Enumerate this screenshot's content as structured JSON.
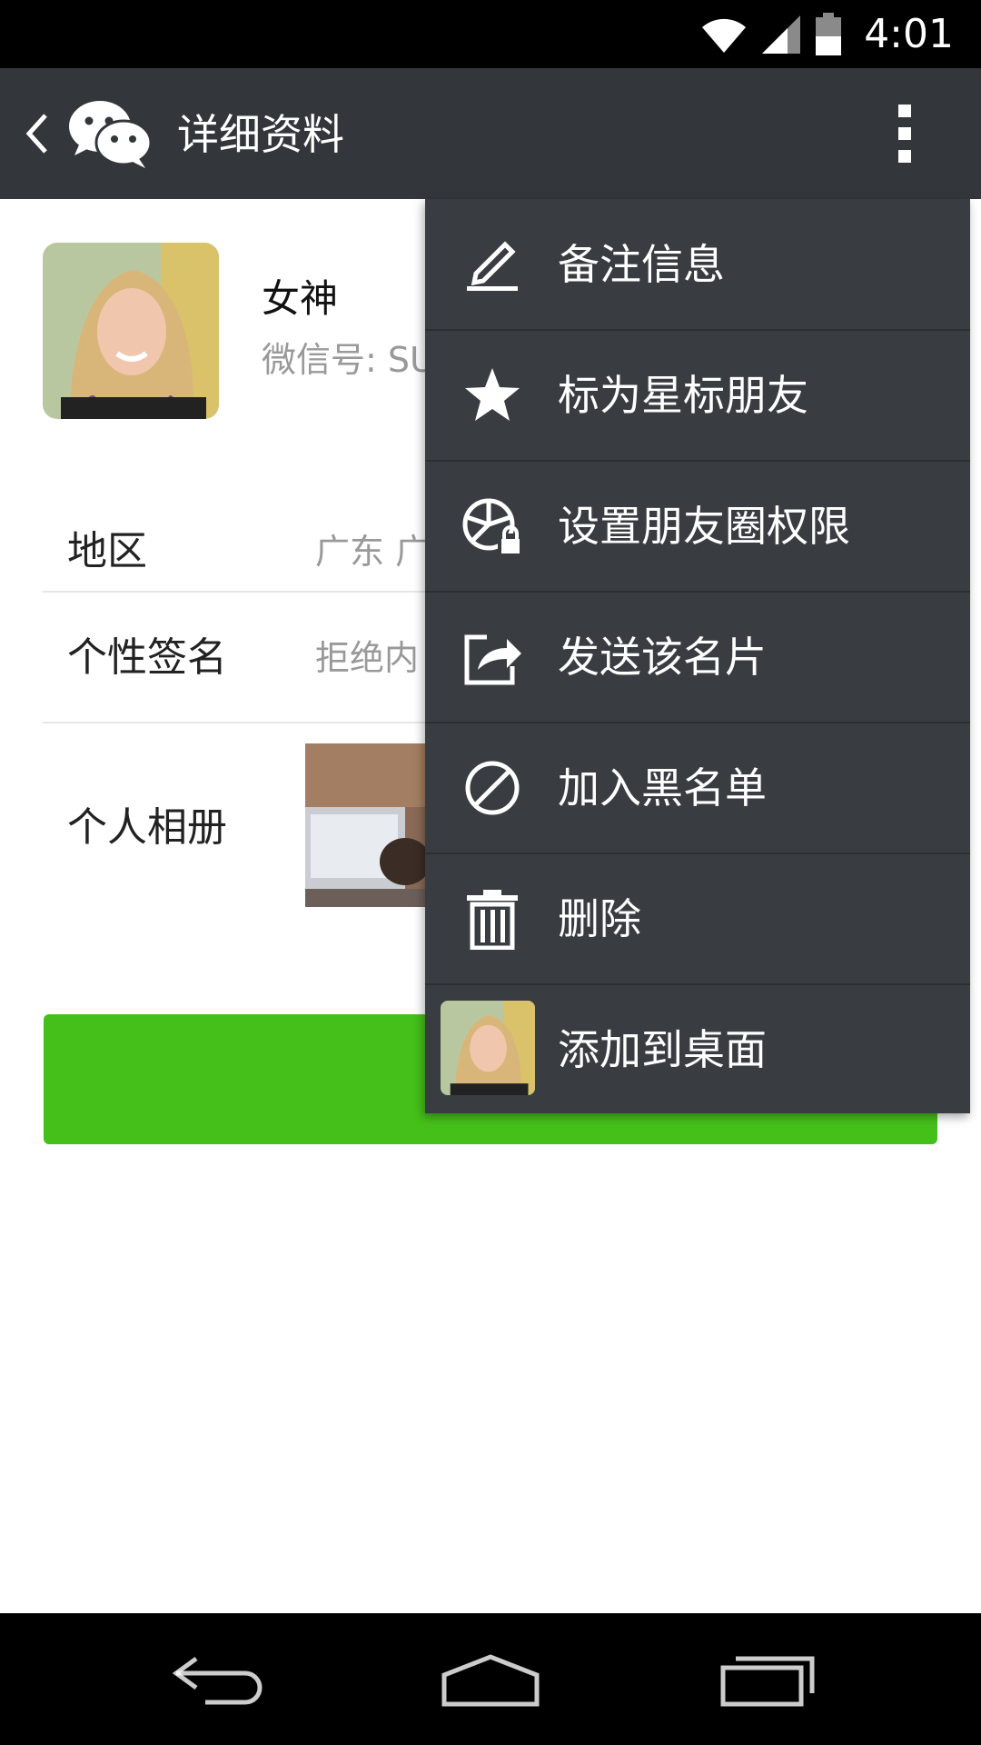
{
  "status_bar": {
    "time": "4:01"
  },
  "header": {
    "title": "详细资料"
  },
  "profile": {
    "name": "女神",
    "wechat_id": "微信号: SU"
  },
  "rows": {
    "region": {
      "label": "地区",
      "value": "广东  广"
    },
    "signature": {
      "label": "个性签名",
      "value": "拒绝内"
    },
    "album": {
      "label": "个人相册"
    }
  },
  "menu": {
    "items": [
      {
        "label": "备注信息",
        "icon": "pencil-icon"
      },
      {
        "label": "标为星标朋友",
        "icon": "star-icon"
      },
      {
        "label": "设置朋友圈权限",
        "icon": "moments-lock-icon"
      },
      {
        "label": "发送该名片",
        "icon": "share-icon"
      },
      {
        "label": "加入黑名单",
        "icon": "block-icon"
      },
      {
        "label": "删除",
        "icon": "trash-icon"
      },
      {
        "label": "添加到桌面",
        "icon": "contact-avatar"
      }
    ]
  },
  "colors": {
    "action_bar": "#33373b",
    "menu_bg": "#393d41",
    "accent_green": "#45c01a"
  }
}
